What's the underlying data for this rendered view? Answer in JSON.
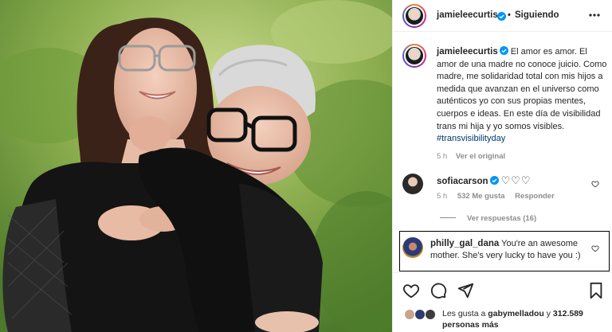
{
  "post": {
    "username": "jamieleecurtis",
    "separator": "•",
    "follow_status": "Siguiendo",
    "more_label": "•••",
    "caption_text": "El amor es amor. El amor de una madre no conoce juicio. Como madre, me solidaridad total con mis hijos a medida que avanzan en el universo como auténticos yo con sus propias mentes, cuerpos e ideas. En este día de visibilidad trans mi hija y yo somos visibles.",
    "caption_hashtag": "#transvisibilityday",
    "caption_time": "5 h",
    "see_original": "Ver el original"
  },
  "comments": [
    {
      "username": "sofiacarson",
      "text": "",
      "emoji": "♡♡♡",
      "time": "5 h",
      "likes": "532 Me gusta",
      "reply": "Responder",
      "view_replies": "Ver respuestas (16)"
    },
    {
      "username": "philly_gal_dana",
      "text": "You're an awesome mother. She's very lucky to have you :)"
    }
  ],
  "likes_summary": {
    "prefix": "Les gusta a",
    "user": "gabymelladou",
    "middle": "y",
    "count": "312.589",
    "suffix": "personas más"
  },
  "icons": {
    "like": "heart-icon",
    "comment": "comment-icon",
    "share": "share-icon",
    "save": "bookmark-icon",
    "more": "more-icon",
    "verified": "verified-badge-icon"
  },
  "colors": {
    "accent_blue": "#0095f6",
    "hashtag": "#00376b",
    "muted": "#8e8e8e",
    "text": "#262626"
  }
}
